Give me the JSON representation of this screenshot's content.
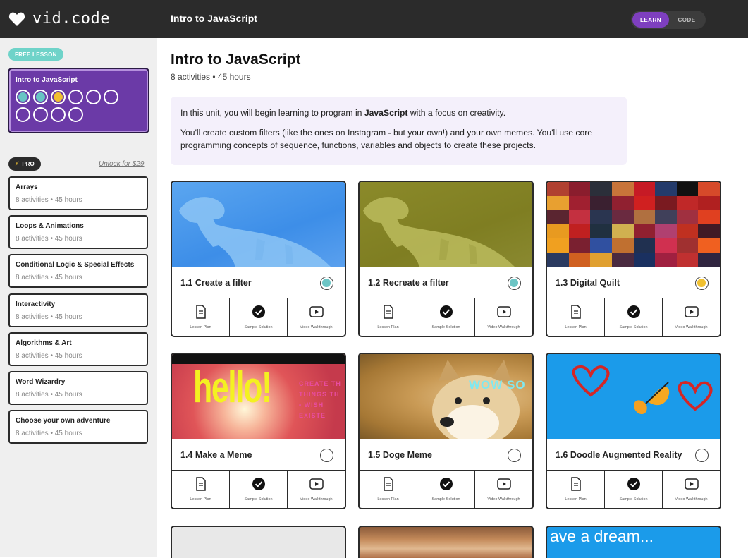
{
  "app": {
    "logo_text": "vid.code",
    "logo_icon": "heart-icon"
  },
  "header": {
    "title": "Intro to JavaScript",
    "toggle": {
      "learn": "LEARN",
      "code": "CODE",
      "selected": "LEARN"
    }
  },
  "sidebar": {
    "free_label": "FREE LESSON",
    "active_unit": {
      "title": "Intro to JavaScript",
      "progress": [
        "teal",
        "teal",
        "gold",
        "empty",
        "empty",
        "empty",
        "empty",
        "empty",
        "empty",
        "empty"
      ]
    },
    "pro_label": "PRO",
    "unlock_label": "Unlock for $29",
    "units": [
      {
        "name": "Arrays",
        "meta": "8 activities • 45 hours"
      },
      {
        "name": "Loops & Animations",
        "meta": "8 activities • 45 hours"
      },
      {
        "name": "Conditional Logic & Special Effects",
        "meta": "8 activities • 45 hours"
      },
      {
        "name": "Interactivity",
        "meta": "8 activities • 45 hours"
      },
      {
        "name": "Algorithms & Art",
        "meta": "8 activities • 45 hours"
      },
      {
        "name": "Word Wizardry",
        "meta": "8 activities • 45 hours"
      },
      {
        "name": "Choose your own adventure",
        "meta": "8 activities • 45 hours"
      }
    ]
  },
  "main": {
    "title": "Intro to JavaScript",
    "meta": "8 activities • 45 hours",
    "desc1_a": "In this unit, you will begin learning to program in ",
    "desc1_b": "JavaScript",
    "desc1_c": " with a focus on creativity.",
    "desc2": "You'll create custom filters (like the ones on Instagram - but your own!) and your own memes. You'll use core programming concepts of sequence, functions, variables and objects to create these projects."
  },
  "button_labels": {
    "lesson": "Lesson Plan",
    "sample": "Sample Solution",
    "video": "Video Walkthrough"
  },
  "activities": [
    {
      "title": "1.1 Create a filter",
      "status": "teal"
    },
    {
      "title": "1.2 Recreate a filter",
      "status": "teal"
    },
    {
      "title": "1.3 Digital Quilt",
      "status": "gold"
    },
    {
      "title": "1.4 Make a Meme",
      "status": "empty",
      "thumb_text": "hello!",
      "thumb_side": [
        "CREATE TH",
        "THINGS TH",
        "• WISH",
        "EXISTE"
      ]
    },
    {
      "title": "1.5 Doge Meme",
      "status": "empty",
      "thumb_text": "WOW SO"
    },
    {
      "title": "1.6 Doodle Augmented Reality",
      "status": "empty"
    }
  ],
  "partial_thumb_text": "ave a dream...",
  "colors": {
    "purple": "#6b3aa7",
    "teal": "#6fd3c9",
    "gold": "#f0c030",
    "header": "#2b2b2b"
  }
}
